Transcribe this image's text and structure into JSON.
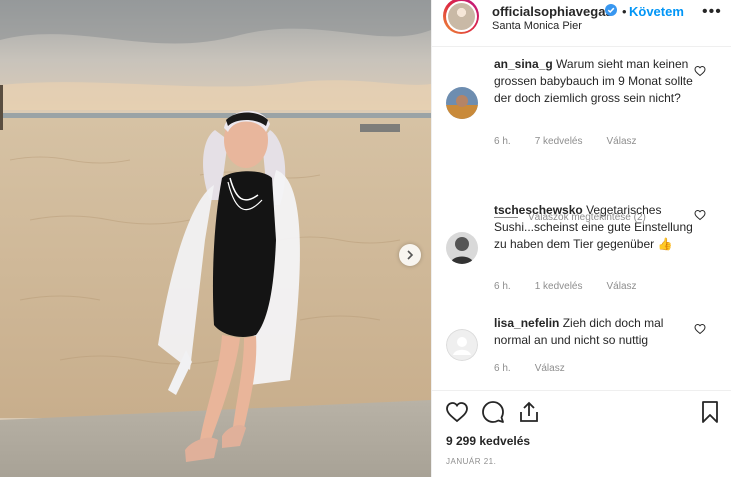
{
  "post": {
    "username": "officialsophiavegas",
    "follow_label": "Követem",
    "dot": "•",
    "location": "Santa Monica Pier",
    "more": "•••"
  },
  "comments": [
    {
      "user": "an_sina_g",
      "text": "Warum sieht man keinen grossen babybauch im 9 Monat sollte der doch ziemlich gross sein nicht?",
      "time": "6 h.",
      "likes": "7 kedvelés",
      "reply": "Válasz",
      "view_replies": "Válaszok megtekintése (2)"
    },
    {
      "user": "tscheschewsko",
      "text": "Vegetarisches Sushi...scheinst eine gute Einstellung zu haben dem Tier gegenüber",
      "emoji": "👍",
      "time": "6 h.",
      "likes": "1 kedvelés",
      "reply": "Válasz"
    },
    {
      "user": "lisa_nefelin",
      "text": "Zieh dich doch mal normal an und nicht so nuttig",
      "time": "6 h.",
      "reply": "Válasz"
    }
  ],
  "footer": {
    "likes": "9 299 kedvelés",
    "date": "JANUÁR 21."
  },
  "icons": {
    "verified": "verified-badge-icon",
    "like": "heart-icon",
    "comment": "comment-icon",
    "share": "share-icon",
    "save": "bookmark-icon",
    "next": "chevron-right-icon"
  },
  "colors": {
    "link_blue": "#0095f6",
    "meta_gray": "#8e8e8e",
    "text": "#262626"
  }
}
